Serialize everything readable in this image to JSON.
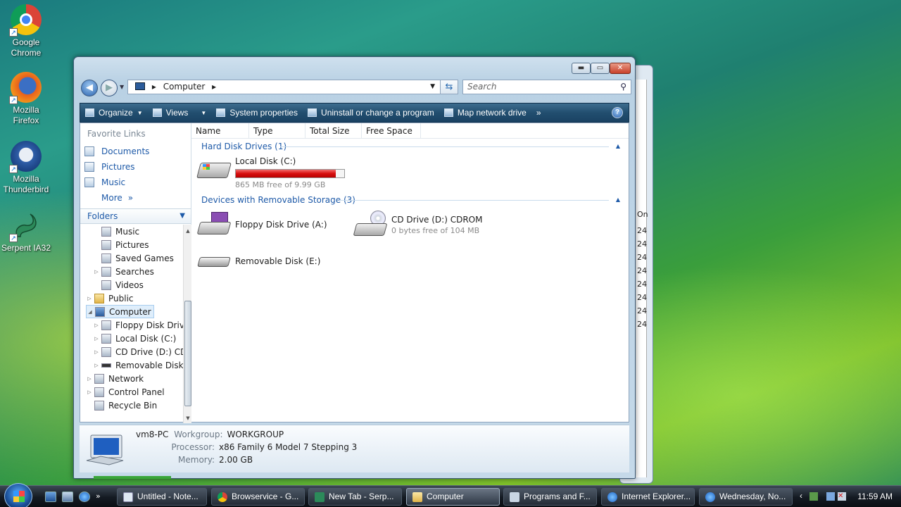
{
  "desktop": {
    "icons": [
      {
        "label_line1": "Google",
        "label_line2": "Chrome"
      },
      {
        "label_line1": "Mozilla",
        "label_line2": "Firefox"
      },
      {
        "label_line1": "Mozilla",
        "label_line2": "Thunderbird"
      },
      {
        "label_line1": "Serpent IA32",
        "label_line2": ""
      }
    ]
  },
  "back_window": {
    "column_header": "On",
    "row_suffix": "24"
  },
  "window": {
    "caption_buttons": {
      "minimize": "▬",
      "maximize": "▭",
      "close": "✕"
    },
    "address": {
      "crumb": "Computer",
      "separator": "▸"
    },
    "search": {
      "placeholder": "Search"
    },
    "toolbar": {
      "organize": "Organize",
      "views": "Views",
      "system_properties": "System properties",
      "uninstall": "Uninstall or change a program",
      "map_network": "Map network drive",
      "more": "»",
      "help": "?"
    },
    "nav": {
      "favorite_links_title": "Favorite Links",
      "favorites": [
        "Documents",
        "Pictures",
        "Music",
        "More"
      ],
      "more_chevron": "»",
      "folders_title": "Folders",
      "tree": [
        {
          "label": "Music"
        },
        {
          "label": "Pictures"
        },
        {
          "label": "Saved Games"
        },
        {
          "label": "Searches"
        },
        {
          "label": "Videos"
        },
        {
          "label": "Public"
        },
        {
          "label": "Computer"
        },
        {
          "label": "Floppy Disk Drive"
        },
        {
          "label": "Local Disk (C:)"
        },
        {
          "label": "CD Drive (D:) CD"
        },
        {
          "label": "Removable Disk"
        },
        {
          "label": "Network"
        },
        {
          "label": "Control Panel"
        },
        {
          "label": "Recycle Bin"
        }
      ]
    },
    "columns": [
      "Name",
      "Type",
      "Total Size",
      "Free Space"
    ],
    "groups": {
      "hard_disks": "Hard Disk Drives (1)",
      "removable": "Devices with Removable Storage (3)"
    },
    "drives": {
      "local_c": {
        "name": "Local Disk (C:)",
        "free": "865 MB free of 9.99 GB",
        "used_fraction": 0.92
      },
      "floppy": {
        "name": "Floppy Disk Drive (A:)"
      },
      "cd": {
        "name": "CD Drive (D:) CDROM",
        "free": "0 bytes free of 104 MB"
      },
      "removable": {
        "name": "Removable Disk (E:)"
      }
    },
    "details": {
      "pc_name": "vm8-PC",
      "workgroup_label": "Workgroup:",
      "workgroup": "WORKGROUP",
      "processor_label": "Processor:",
      "processor": "x86 Family 6 Model 7 Stepping 3",
      "memory_label": "Memory:",
      "memory": "2.00 GB"
    }
  },
  "taskbar": {
    "tasks": [
      "Untitled - Note...",
      "Browservice - G...",
      "New Tab - Serp...",
      "Computer",
      "Programs and F...",
      "Internet Explorer...",
      "Wednesday, No..."
    ],
    "tray_chevron": "‹",
    "clock": "11:59 AM"
  },
  "colors": {
    "accent": "#1e5aa8",
    "capacity_bar": "#d70f0f",
    "toolbar": "#224e6f"
  }
}
